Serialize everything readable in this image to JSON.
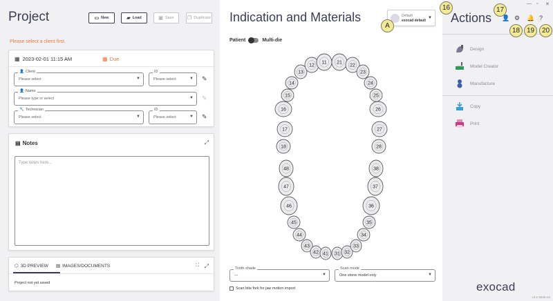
{
  "project": {
    "title": "Project",
    "buttons": {
      "new": "New",
      "load": "Load",
      "save": "Save",
      "duplicate": "Duplicate"
    },
    "warning": "Please select a client first.",
    "datetime": "2023-02-01 11:15 AM",
    "due_label": "Due",
    "client": {
      "label": "Client",
      "placeholder": "Please select"
    },
    "client_id": {
      "label": "ID",
      "placeholder": "Please select"
    },
    "name": {
      "label": "Name",
      "placeholder": "Please type or select"
    },
    "technician": {
      "label": "Technician",
      "placeholder": "Please select"
    },
    "technician_id": {
      "label": "ID",
      "placeholder": "Please select"
    }
  },
  "notes": {
    "title": "Notes",
    "placeholder": "Type notes here..."
  },
  "preview": {
    "tab_3d": "3D PREVIEW",
    "tab_images": "IMAGES/DOCUMENTS",
    "status": "Project not yet saved"
  },
  "indication": {
    "title": "Indication and Materials",
    "default_line1": "Default",
    "default_line2": "exocad default",
    "toggle_left": "Patient",
    "toggle_right": "Multi-die",
    "tooth_shade": {
      "label": "Tooth shade",
      "value": "---"
    },
    "scan_mode": {
      "label": "Scan mode",
      "value": "One stone model only"
    },
    "bite_fork": "Scan bite fork for jaw motion import",
    "teeth": {
      "upper": [
        "18",
        "17",
        "16",
        "15",
        "14",
        "13",
        "12",
        "11",
        "21",
        "22",
        "23",
        "24",
        "25",
        "26",
        "27",
        "28"
      ],
      "lower": [
        "48",
        "47",
        "46",
        "45",
        "44",
        "43",
        "42",
        "41",
        "31",
        "32",
        "33",
        "34",
        "35",
        "36",
        "37",
        "38"
      ]
    }
  },
  "actions": {
    "title": "Actions",
    "items": [
      {
        "label": "Design",
        "icon": "design-icon"
      },
      {
        "label": "Model Creator",
        "icon": "model-creator-icon"
      },
      {
        "label": "Manufacture",
        "icon": "manufacture-icon"
      },
      {
        "label": "Copy",
        "icon": "copy-icon"
      },
      {
        "label": "Print",
        "icon": "print-icon"
      }
    ],
    "logo": "exocad",
    "version": "v3.1-8345-04"
  },
  "callouts": {
    "a": "A",
    "c16": "16",
    "c17": "17",
    "c18": "18",
    "c19": "19",
    "c20": "20"
  },
  "colors": {
    "brand": "#3b3d55",
    "warning": "#e9783f",
    "callout": "#f3ea98"
  }
}
